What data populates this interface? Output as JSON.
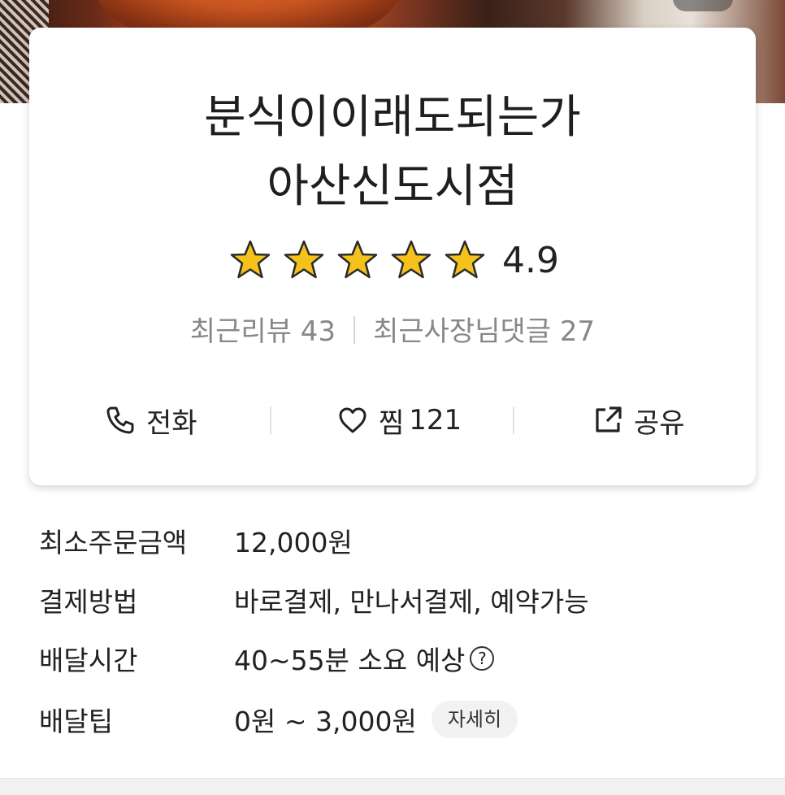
{
  "store": {
    "name_line1": "분식이이래도되는가",
    "name_line2": "아산신도시점",
    "rating": "4.9",
    "stars": 5,
    "star_color": "#f5c11b",
    "recent_reviews_label": "최근리뷰 43",
    "recent_owner_replies_label": "최근사장님댓글 27"
  },
  "actions": {
    "call_label": "전화",
    "like_label": "찜",
    "like_count": "121",
    "share_label": "공유"
  },
  "info": {
    "min_order_label": "최소주문금액",
    "min_order_value": "12,000원",
    "payment_label": "결제방법",
    "payment_value": "바로결제, 만나서결제, 예약가능",
    "delivery_time_label": "배달시간",
    "delivery_time_value": "40~55분 소요 예상",
    "delivery_tip_label": "배달팁",
    "delivery_tip_value": "0원 ~ 3,000원",
    "detail_button": "자세히",
    "help_icon": "question-circle-icon"
  }
}
